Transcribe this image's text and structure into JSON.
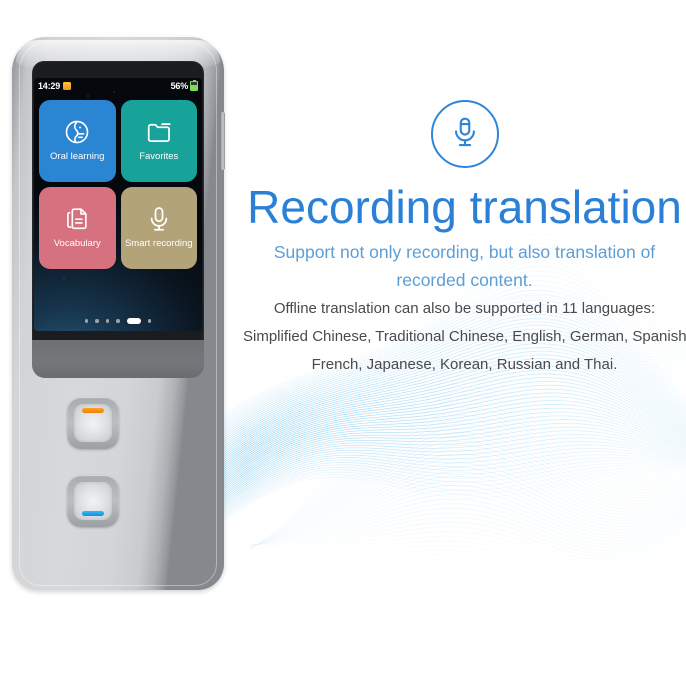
{
  "device": {
    "status_bar": {
      "time": "14:29",
      "badge_icon": "alarm-badge-icon",
      "battery_text": "56%",
      "battery_icon": "battery-icon"
    },
    "tiles": [
      {
        "label": "Oral learning",
        "icon": "head-profile-icon",
        "color": "#2a85d2"
      },
      {
        "label": "Favorites",
        "icon": "folder-icon",
        "color": "#17a39a"
      },
      {
        "label": "Vocabulary",
        "icon": "documents-icon",
        "color": "#d6717f"
      },
      {
        "label": "Smart recording",
        "icon": "microphone-icon",
        "color": "#b2a379"
      }
    ],
    "page_dots": {
      "count": 6,
      "active_index": 4
    },
    "buttons": [
      {
        "name": "translate-button-top",
        "led_color": "#f08c0e"
      },
      {
        "name": "translate-button-bottom",
        "led_color": "#17a2e8"
      }
    ]
  },
  "content": {
    "mic_icon": "microphone-icon",
    "headline": "Recording translation",
    "subhead_lines": [
      "Support not only recording, but also translation of",
      "recorded content."
    ],
    "body_lines": [
      "Offline translation can also be supported in 11 languages:",
      "Simplified Chinese, Traditional Chinese, English, German, Spanish,",
      "French, Japanese, Korean, Russian and Thai."
    ]
  },
  "colors": {
    "headline": "#2980d6",
    "subhead": "#5c9ed8",
    "body": "#4a4a4a",
    "accent": "#2e86d8",
    "background": "#ffffff"
  }
}
